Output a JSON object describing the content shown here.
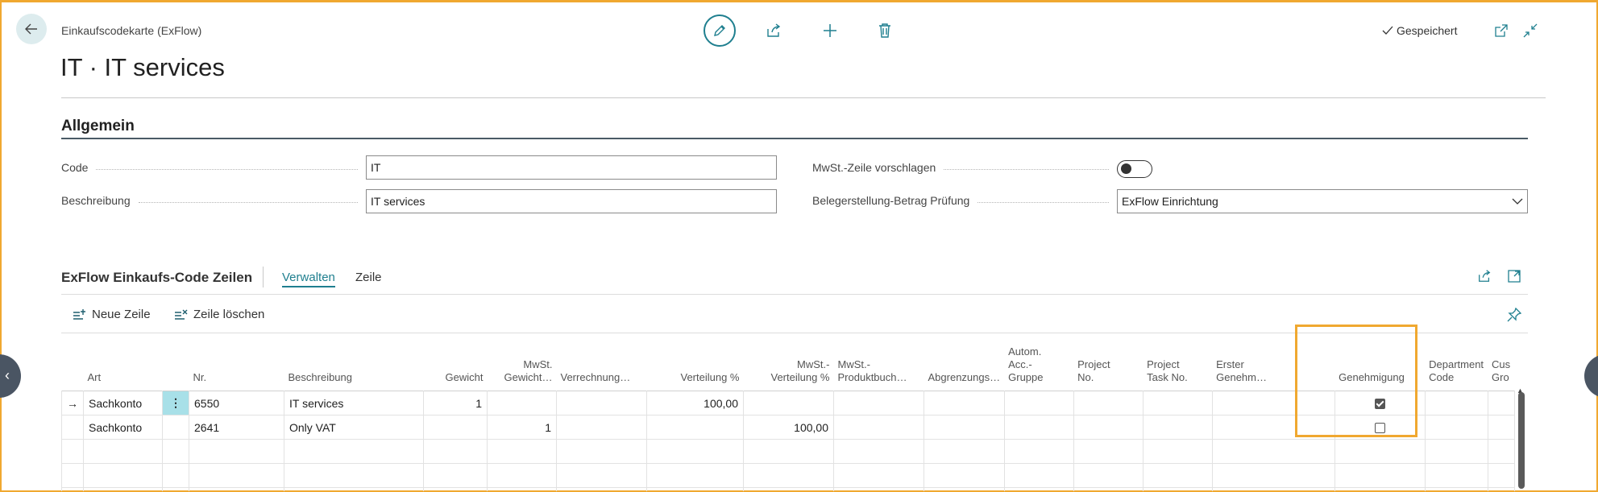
{
  "header": {
    "breadcrumb": "Einkaufscodekarte (ExFlow)",
    "title": "IT · IT services",
    "saved_label": "Gespeichert"
  },
  "general": {
    "section_title": "Allgemein",
    "code_label": "Code",
    "code_value": "IT",
    "description_label": "Beschreibung",
    "description_value": "IT services",
    "vat_line_label": "MwSt.-Zeile vorschlagen",
    "vat_line_enabled": false,
    "amount_check_label": "Belegerstellung-Betrag Prüfung",
    "amount_check_value": "ExFlow Einrichtung"
  },
  "lines": {
    "title": "ExFlow Einkaufs-Code Zeilen",
    "tabs": [
      "Verwalten",
      "Zeile"
    ],
    "actions": {
      "new_line": "Neue Zeile",
      "delete_line": "Zeile löschen"
    },
    "columns": [
      "Art",
      "Nr.",
      "Beschreibung",
      "Gewicht",
      "MwSt. Gewicht…",
      "Verrechnung…",
      "Verteilung %",
      "MwSt.- Verteilung %",
      "MwSt.- Produktbuch…",
      "Abgrenzungs…",
      "Autom. Acc.- Gruppe",
      "Project No.",
      "Project Task No.",
      "Erster Genehm…",
      "Genehmigung",
      "Department Code",
      "Cus Gro"
    ],
    "rows": [
      {
        "marker": "→",
        "art": "Sachkonto",
        "nr": "6550",
        "beschreibung": "IT services",
        "gewicht": "1",
        "mwst_gewicht": "",
        "verteilung": "100,00",
        "mwst_verteilung": "",
        "genehmigung": true
      },
      {
        "marker": "",
        "art": "Sachkonto",
        "nr": "2641",
        "beschreibung": "Only VAT",
        "gewicht": "",
        "mwst_gewicht": "1",
        "verteilung": "",
        "mwst_verteilung": "100,00",
        "genehmigung": false
      }
    ]
  },
  "colors": {
    "accent": "#1f7f8f",
    "highlight": "#f0a830",
    "selected_cell": "#a8e0e8"
  }
}
